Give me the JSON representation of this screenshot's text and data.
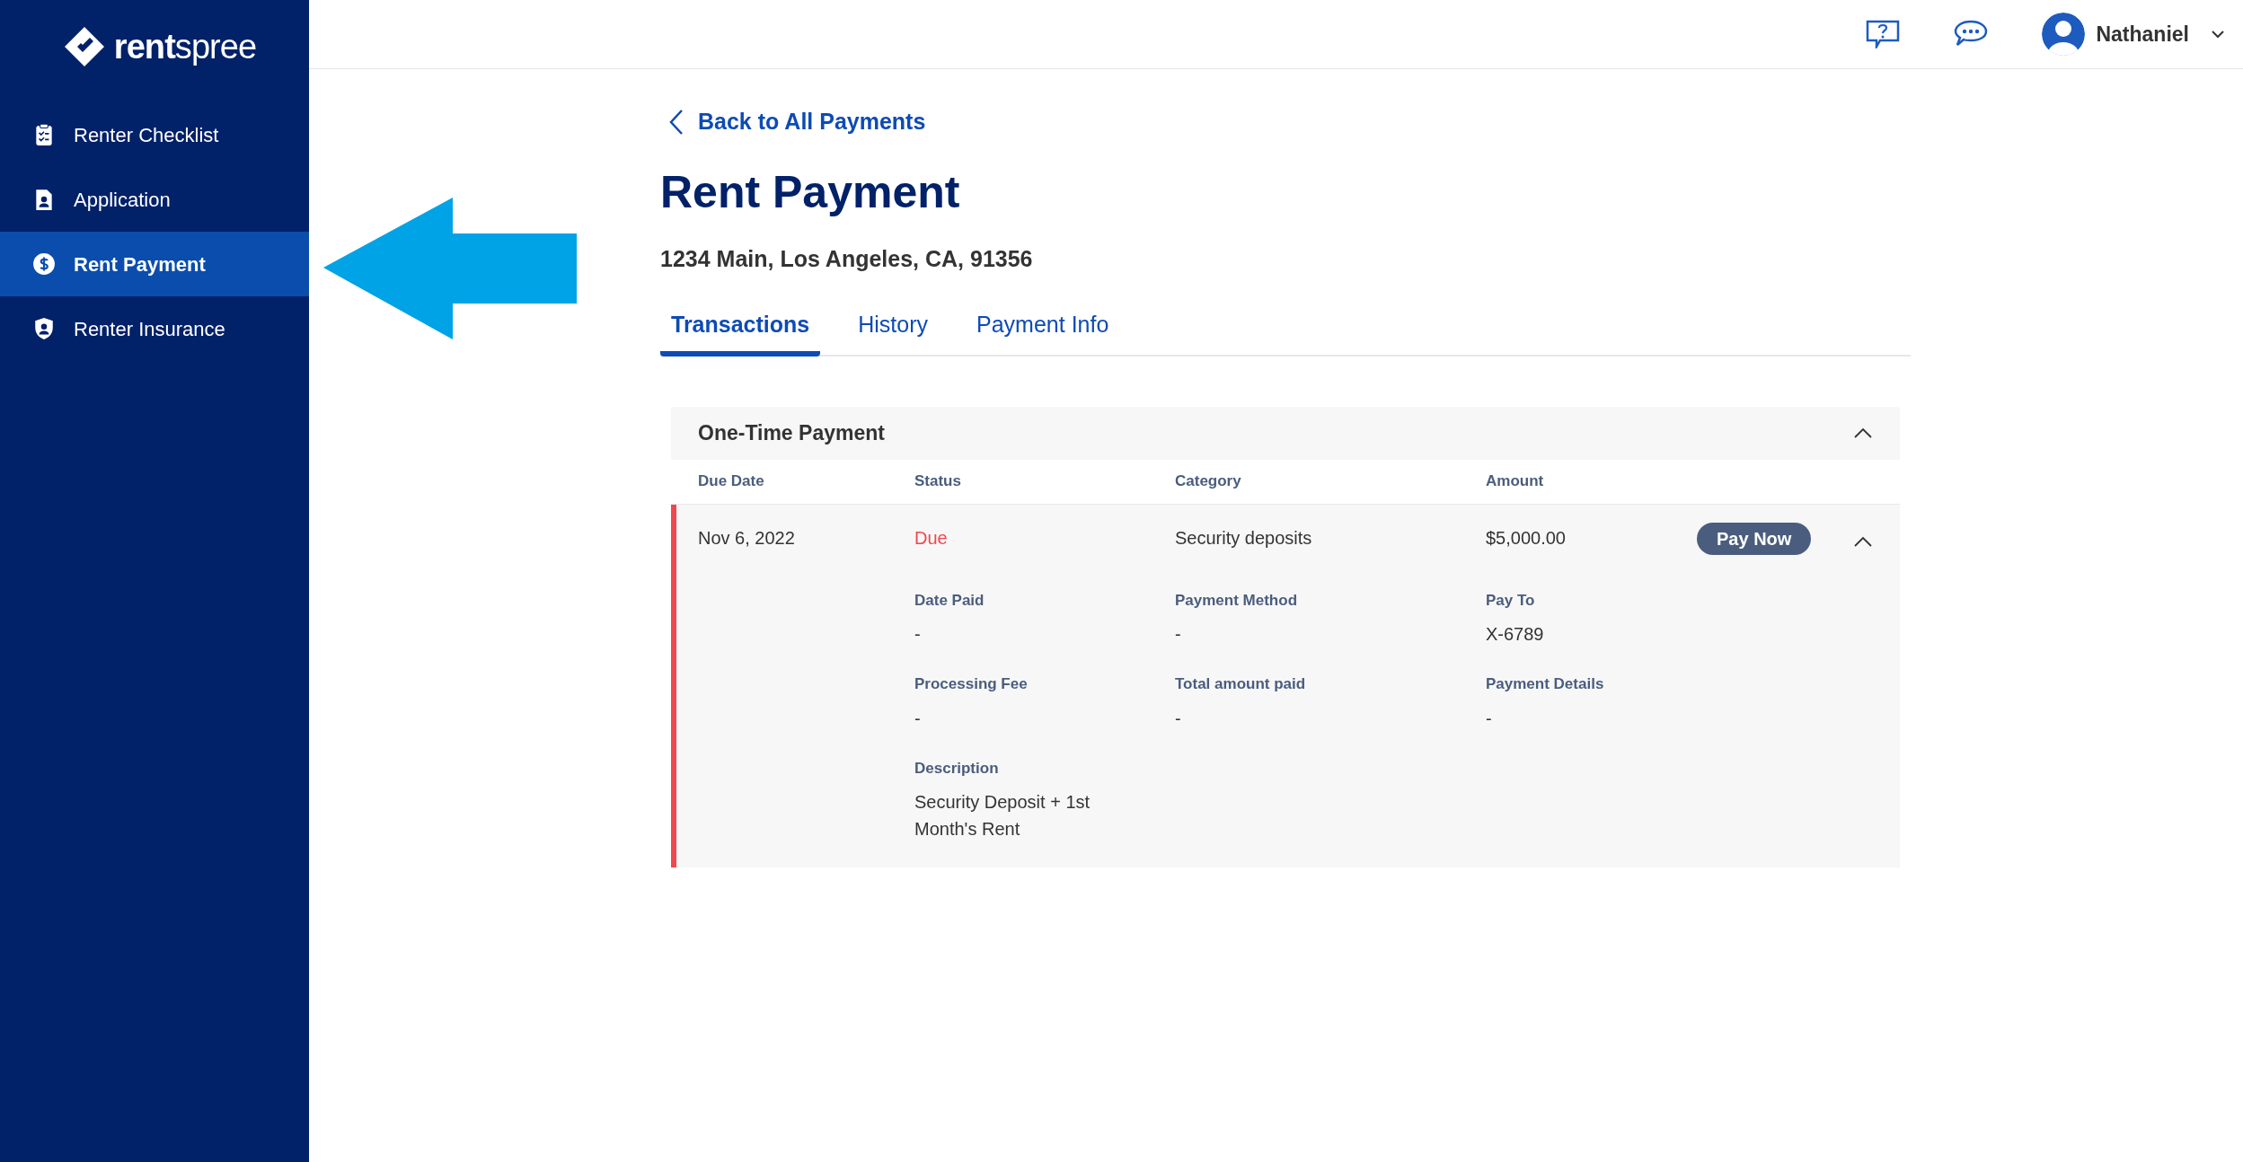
{
  "logo": {
    "text": "**rent**spree"
  },
  "sidebar": {
    "items": [
      {
        "label": "Renter Checklist",
        "selected": false
      },
      {
        "label": "Application",
        "selected": false
      },
      {
        "label": "Rent Payment",
        "selected": true
      },
      {
        "label": "Renter Insurance",
        "selected": false
      }
    ]
  },
  "top_bar": {
    "user_name": "Nathaniel"
  },
  "back_link": "Back to All Payments",
  "title": "Rent Payment",
  "address": "1234 Main, Los Angeles, CA, 91356",
  "tabs": [
    {
      "label": "Transactions",
      "selected": true
    },
    {
      "label": "History",
      "selected": false
    },
    {
      "label": "Payment Info",
      "selected": false
    }
  ],
  "section": {
    "title": "One-Time Payment",
    "expanded": true,
    "columns": [
      "Due Date",
      "Status",
      "Category",
      "Amount"
    ],
    "rows": [
      {
        "due_date": "Nov 6, 2022",
        "status": "Due",
        "color": "#f0484e",
        "category": "Security deposits",
        "amount": "$5,000.00",
        "action": "Pay Now",
        "expanded": true,
        "details": [
          {
            "label": "Date Paid",
            "value": "-"
          },
          {
            "label": "Payment Method",
            "value": "-"
          },
          {
            "label": "Pay To",
            "value": "X-6789"
          },
          {
            "label": "Processing Fee",
            "value": "-"
          },
          {
            "label": "Total amount paid",
            "value": "-"
          },
          {
            "label": "Payment Details",
            "value": "-"
          }
        ],
        "description": {
          "label": "Description",
          "value": "Security Deposit + 1st Month's Rent"
        }
      }
    ]
  }
}
